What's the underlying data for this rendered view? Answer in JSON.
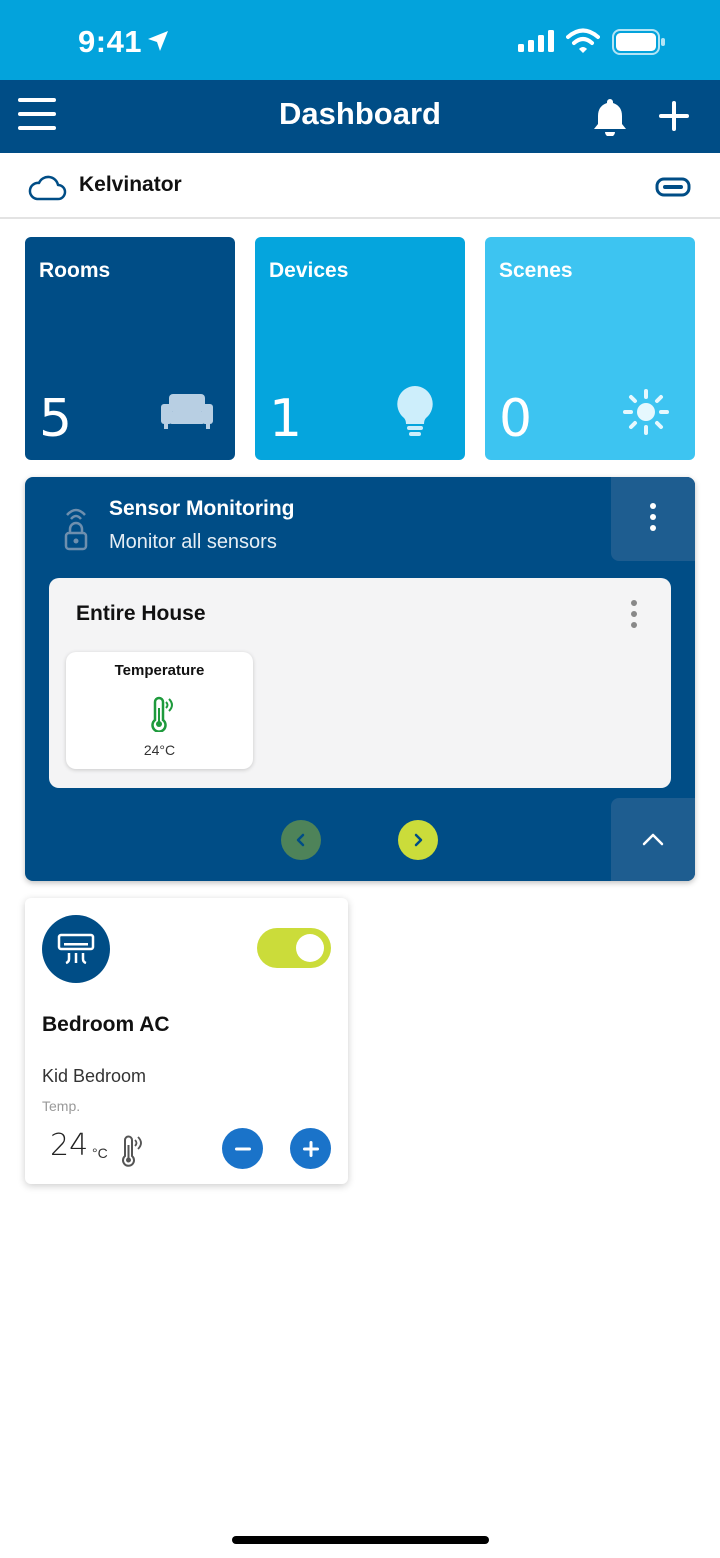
{
  "status_bar": {
    "time": "9:41"
  },
  "header": {
    "title": "Dashboard"
  },
  "home": {
    "name": "Kelvinator"
  },
  "tiles": [
    {
      "label": "Rooms",
      "count": "5",
      "icon": "sofa-icon",
      "color": "#004d86"
    },
    {
      "label": "Devices",
      "count": "1",
      "icon": "bulb-icon",
      "color": "#05a5dd"
    },
    {
      "label": "Scenes",
      "count": "0",
      "icon": "sun-icon",
      "color": "#3dc4f1"
    }
  ],
  "sensor_monitoring": {
    "title": "Sensor Monitoring",
    "subtitle": "Monitor all sensors",
    "group": {
      "title": "Entire House",
      "sensors": [
        {
          "label": "Temperature",
          "value": "24°C",
          "icon": "thermometer-icon"
        }
      ]
    }
  },
  "device_card": {
    "name": "Bedroom AC",
    "room": "Kid Bedroom",
    "temp_label": "Temp.",
    "temp_value": "24",
    "temp_unit": "°C",
    "power_on": true,
    "icon": "air-conditioner-icon"
  },
  "colors": {
    "primary": "#004d86",
    "accent": "#03a3dc",
    "toggle_on": "#cbdc3a",
    "button": "#1a73c9"
  }
}
